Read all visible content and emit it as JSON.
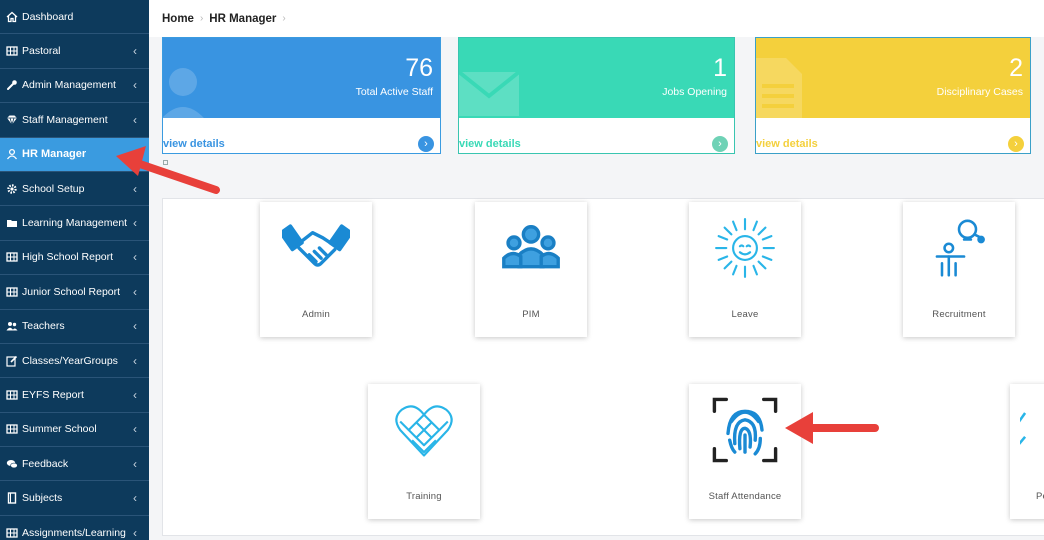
{
  "sidebar": {
    "items": [
      {
        "label": "Dashboard",
        "icon": "home-icon",
        "chevron": false
      },
      {
        "label": "Pastoral",
        "icon": "grid-icon",
        "chevron": true
      },
      {
        "label": "Admin Management",
        "icon": "wrench-icon",
        "chevron": true
      },
      {
        "label": "Staff Management",
        "icon": "diamond-icon",
        "chevron": true
      },
      {
        "label": "HR Manager",
        "icon": "user-circle-icon",
        "chevron": false,
        "active": true
      },
      {
        "label": "School Setup",
        "icon": "gear-icon",
        "chevron": true
      },
      {
        "label": "Learning Management",
        "icon": "folder-icon",
        "chevron": true
      },
      {
        "label": "High School Report",
        "icon": "grid-icon",
        "chevron": true
      },
      {
        "label": "Junior School Report",
        "icon": "grid-icon",
        "chevron": true
      },
      {
        "label": "Teachers",
        "icon": "users-icon",
        "chevron": true
      },
      {
        "label": "Classes/YearGroups",
        "icon": "edit-icon",
        "chevron": true
      },
      {
        "label": "EYFS Report",
        "icon": "grid-icon",
        "chevron": true
      },
      {
        "label": "Summer School",
        "icon": "grid-icon",
        "chevron": true
      },
      {
        "label": "Feedback",
        "icon": "comments-icon",
        "chevron": true
      },
      {
        "label": "Subjects",
        "icon": "book-icon",
        "chevron": true
      },
      {
        "label": "Assignments/Learning",
        "icon": "grid-icon",
        "chevron": true
      }
    ],
    "chevron_glyph": "‹"
  },
  "breadcrumb": {
    "home": "Home",
    "current": "HR Manager",
    "separator": "›"
  },
  "stats": [
    {
      "value": "76",
      "label": "Total Active Staff",
      "link": "view details",
      "color": "#3994e1"
    },
    {
      "value": "1",
      "label": "Jobs Opening",
      "link": "view details",
      "color": "#39d9b6"
    },
    {
      "value": "2",
      "label": "Disciplinary Cases",
      "link": "view details",
      "color": "#f4d03c"
    }
  ],
  "tiles": [
    {
      "label": "Admin",
      "icon": "handshake-icon"
    },
    {
      "label": "PIM",
      "icon": "group-icon"
    },
    {
      "label": "Leave",
      "icon": "sun-icon"
    },
    {
      "label": "Recruitment",
      "icon": "recruitment-icon"
    },
    {
      "label": "Training",
      "icon": "heart-icon"
    },
    {
      "label": "Staff Attendance",
      "icon": "fingerprint-icon"
    },
    {
      "label": "Pe",
      "icon": "partial-icon"
    }
  ],
  "colors": {
    "sidebar_bg": "#0d3a5c",
    "active": "#3a9be0",
    "icon_blue": "#1a8ad4",
    "annotation_arrow": "#e8403a"
  }
}
